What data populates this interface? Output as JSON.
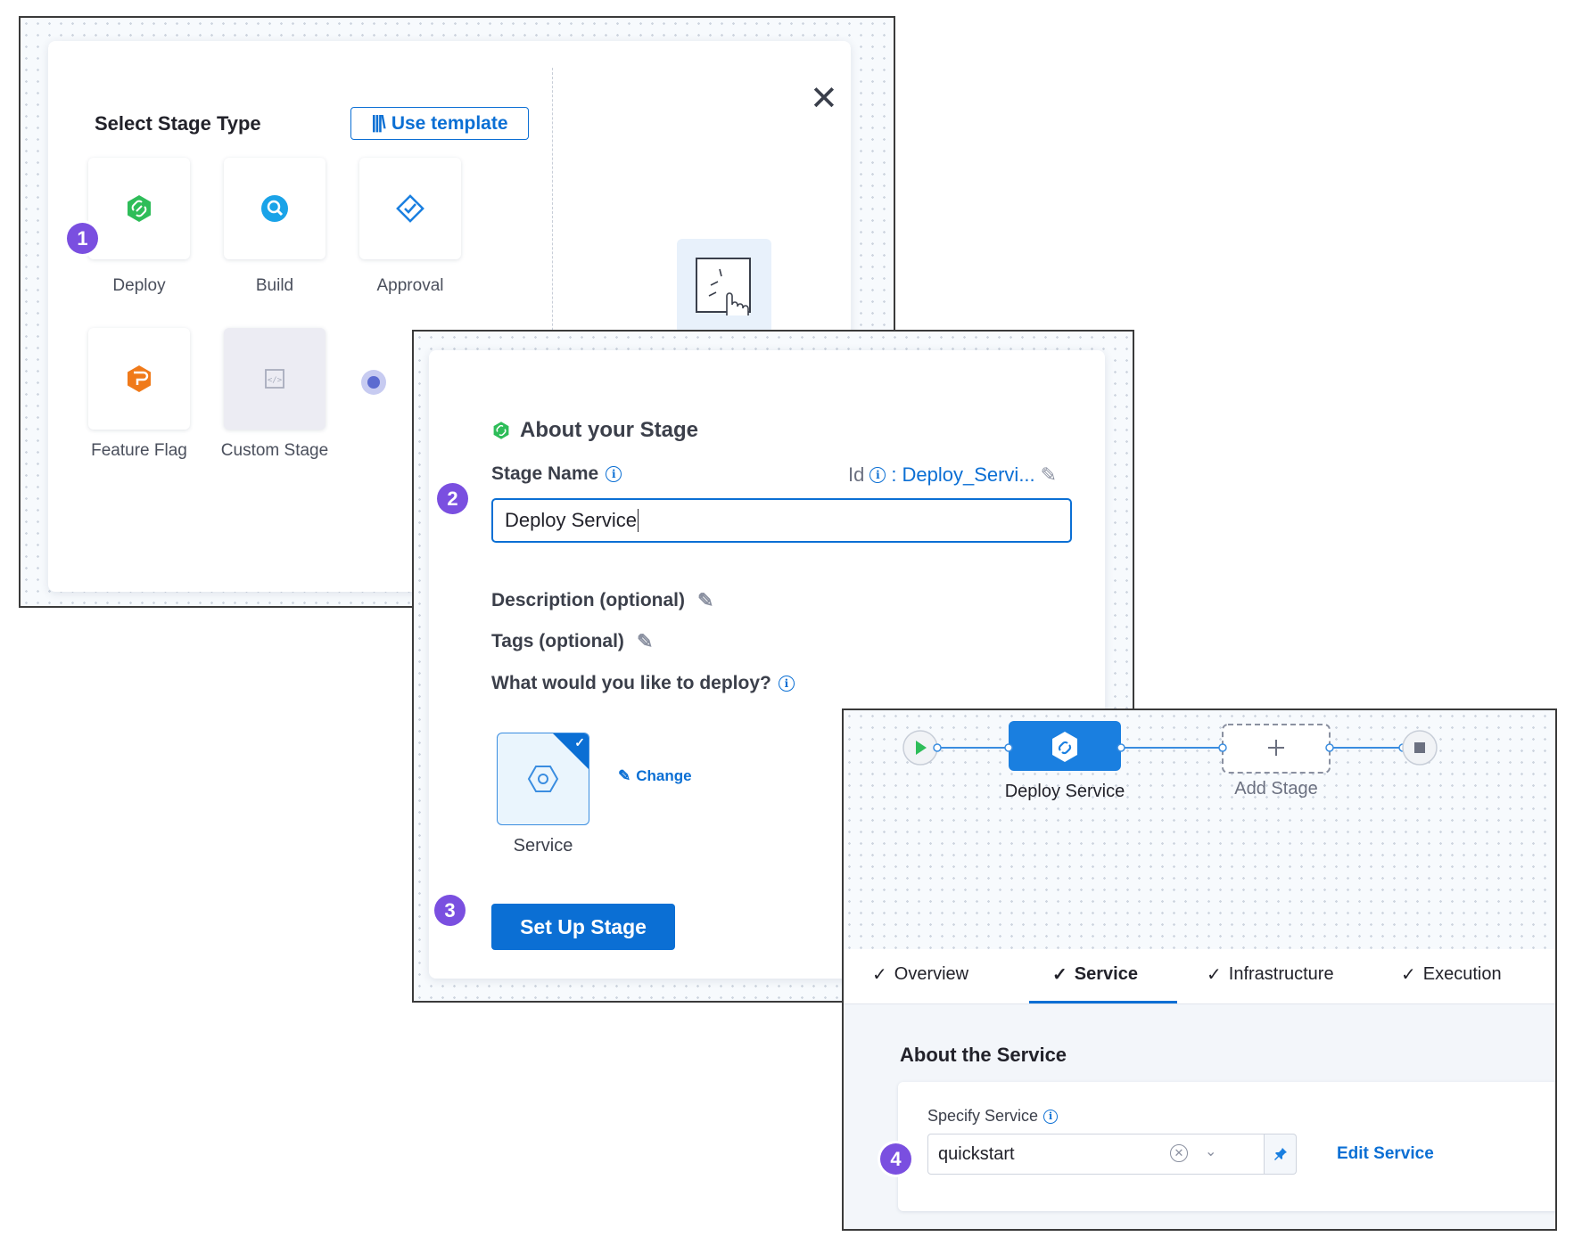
{
  "select_stage": {
    "title": "Select Stage Type",
    "use_template_label": "Use template",
    "close_icon": "close-icon",
    "tiles": [
      {
        "label": "Deploy",
        "icon": "deploy-icon"
      },
      {
        "label": "Build",
        "icon": "build-icon"
      },
      {
        "label": "Approval",
        "icon": "approval-icon"
      },
      {
        "label": "Feature Flag",
        "icon": "feature-flag-icon"
      },
      {
        "label": "Custom Stage",
        "icon": "custom-stage-icon"
      }
    ]
  },
  "about_stage": {
    "title": "About your Stage",
    "stage_name_label": "Stage Name",
    "id_label": "Id",
    "id_sep": ":",
    "id_value": "Deploy_Servi...",
    "stage_name_value": "Deploy Service",
    "description_label": "Description (optional)",
    "tags_label": "Tags (optional)",
    "deploy_question": "What would you like to deploy?",
    "service_tile_label": "Service",
    "change_label": "Change",
    "setup_button": "Set Up Stage"
  },
  "pipeline": {
    "stage_label": "Deploy Service",
    "add_stage_label": "Add Stage",
    "tabs": [
      {
        "label": "Overview",
        "active": false
      },
      {
        "label": "Service",
        "active": true
      },
      {
        "label": "Infrastructure",
        "active": false
      },
      {
        "label": "Execution",
        "active": false
      }
    ],
    "about_service_title": "About the Service",
    "specify_service_label": "Specify Service",
    "service_value": "quickstart",
    "edit_service_label": "Edit Service"
  },
  "steps": [
    "1",
    "2",
    "3",
    "4"
  ],
  "colors": {
    "accent": "#0b6fd4",
    "badge": "#7a4fe0",
    "deploy_green": "#2ebd59"
  }
}
